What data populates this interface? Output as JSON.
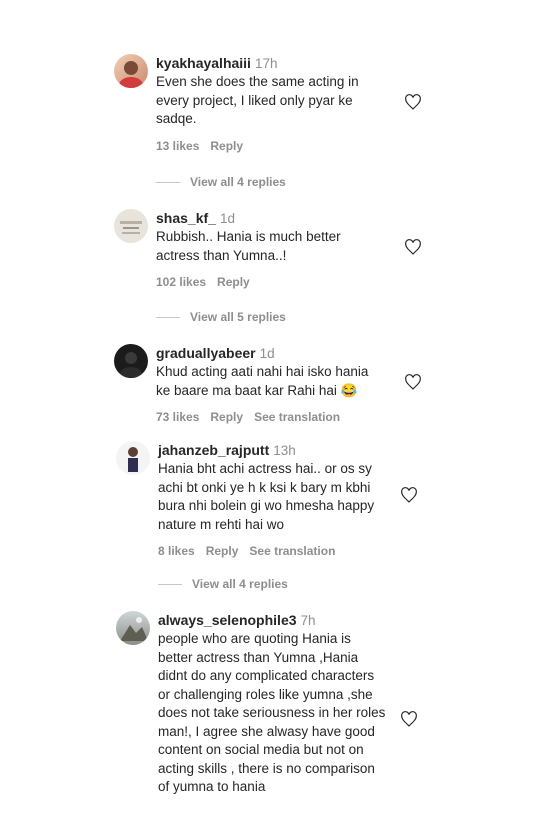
{
  "comments": [
    {
      "username": "kyakhayalhaiii",
      "time": "17h",
      "text": "Even she does the same acting in every project, I liked only pyar ke sadqe.",
      "likes": "13 likes",
      "reply": "Reply",
      "view_replies": "View all 4 replies"
    },
    {
      "username": "shas_kf_",
      "time": "1d",
      "text": "Rubbish.. Hania is much better actress than Yumna..!",
      "likes": "102 likes",
      "reply": "Reply",
      "view_replies": "View all 5 replies"
    },
    {
      "username": "graduallyabeer",
      "time": "1d",
      "text": "Khud acting aati nahi hai isko hania ke baare ma baat kar Rahi hai 😂",
      "likes": "73 likes",
      "reply": "Reply",
      "see_translation": "See translation"
    },
    {
      "username": "jahanzeb_rajputt",
      "time": "13h",
      "text": "Hania bht achi actress hai.. or os sy achi bt onki ye h k ksi k bary m kbhi bura nhi bolein gi wo hmesha happy nature m rehti hai wo",
      "likes": "8 likes",
      "reply": "Reply",
      "see_translation": "See translation",
      "view_replies": "View all 4 replies"
    },
    {
      "username": "always_selenophile3",
      "time": "7h",
      "text": "people who are quoting Hania is better actress than Yumna ,Hania didnt do any complicated characters or challenging roles like yumna ,she does not take seriousness in her roles man!, I agree she alwasy have good content on social media but not on acting skills , there is no comparison of yumna to hania"
    }
  ],
  "icons": {
    "heart": "heart-outline-icon"
  }
}
